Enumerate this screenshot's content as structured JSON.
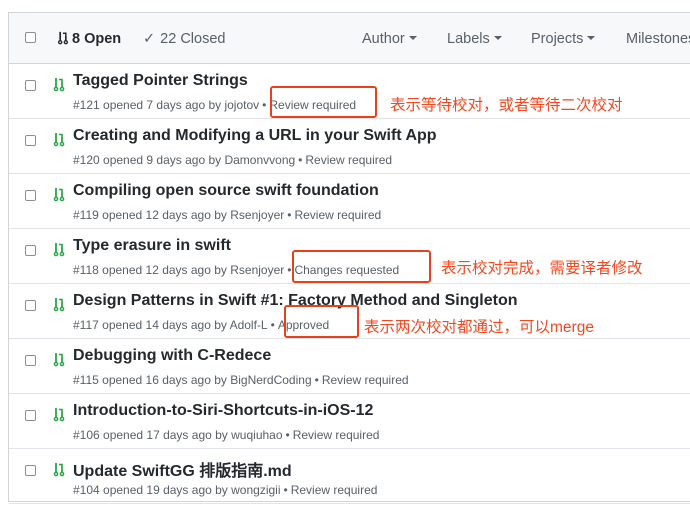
{
  "header": {
    "open_label": "8 Open",
    "closed_label": "22 Closed",
    "filters": [
      "Author",
      "Labels",
      "Projects",
      "Milestones"
    ]
  },
  "pulls": [
    {
      "title": "Tagged Pointer Strings",
      "meta": "#121 opened 7 days ago by jojotov",
      "status": "Review required"
    },
    {
      "title": "Creating and Modifying a URL in your Swift App",
      "meta": "#120 opened 9 days ago by Damonvvong",
      "status": "Review required"
    },
    {
      "title": "Compiling open source swift foundation",
      "meta": "#119 opened 12 days ago by Rsenjoyer",
      "status": "Review required"
    },
    {
      "title": "Type erasure in swift",
      "meta": "#118 opened 12 days ago by Rsenjoyer",
      "status": "Changes requested"
    },
    {
      "title": "Design Patterns in Swift #1: Factory Method and Singleton",
      "meta": "#117 opened 14 days ago by Adolf-L",
      "status": "Approved"
    },
    {
      "title": "Debugging with C-Redece",
      "meta": "#115 opened 16 days ago by BigNerdCoding",
      "status": "Review required"
    },
    {
      "title": "Introduction-to-Siri-Shortcuts-in-iOS-12",
      "meta": "#106 opened 17 days ago by wuqiuhao",
      "status": "Review required"
    },
    {
      "title": "Update SwiftGG 排版指南.md",
      "meta": "#104 opened 19 days ago by wongzigii",
      "status": "Review required"
    }
  ],
  "annotations": {
    "review_required": "表示等待校对，或者等待二次校对",
    "changes_requested": "表示校对完成，需要译者修改",
    "approved": "表示两次校对都通过，可以merge"
  },
  "icons": {
    "state": "check-icon",
    "pr": "pull-request-icon"
  },
  "colors": {
    "annotation": "#f04a22",
    "pr_icon": "#28a745"
  }
}
